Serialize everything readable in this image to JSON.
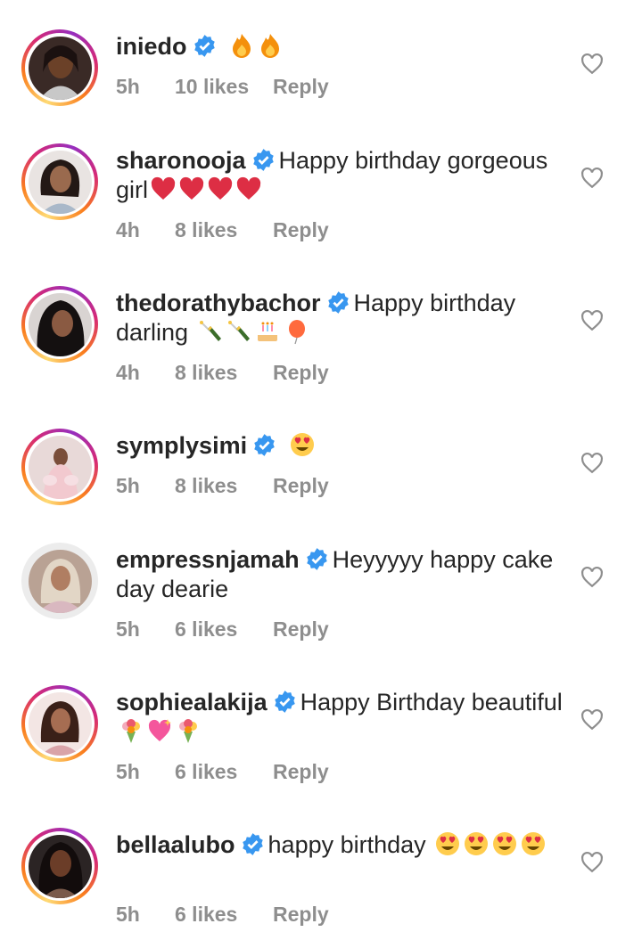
{
  "comments": [
    {
      "username": "iniedo",
      "text": "",
      "emoji": [
        "fire",
        "fire"
      ],
      "time": "5h",
      "likes": "10 likes",
      "reply": "Reply"
    },
    {
      "username": "sharonooja",
      "text": "Happy birthday gorgeous girl",
      "emoji": [
        "heart",
        "heart",
        "heart",
        "heart"
      ],
      "time": "4h",
      "likes": "8 likes",
      "reply": "Reply"
    },
    {
      "username": "thedorathybachor",
      "text": "Happy birthday darling",
      "emoji": [
        "champagne",
        "champagne",
        "cake",
        "balloon"
      ],
      "time": "4h",
      "likes": "8 likes",
      "reply": "Reply"
    },
    {
      "username": "symplysimi",
      "text": "",
      "emoji": [
        "heart-eyes"
      ],
      "time": "5h",
      "likes": "8 likes",
      "reply": "Reply"
    },
    {
      "username": "empressnjamah",
      "text": "Heyyyyy happy cake day dearie",
      "emoji": [],
      "time": "5h",
      "likes": "6 likes",
      "reply": "Reply"
    },
    {
      "username": "sophiealakija",
      "text": "Happy Birthday beautiful",
      "emoji": [
        "bouquet",
        "sparkling-heart",
        "bouquet"
      ],
      "time": "5h",
      "likes": "6 likes",
      "reply": "Reply"
    },
    {
      "username": "bellaalubo",
      "text": "happy birthday",
      "emoji": [
        "heart-eyes",
        "heart-eyes",
        "heart-eyes",
        "heart-eyes"
      ],
      "time": "5h",
      "likes": "6 likes",
      "reply": "Reply"
    }
  ],
  "colors": {
    "verified": "#3897f0",
    "meta": "#8e8e8e",
    "text": "#262626",
    "heart_outline": "#8e8e8e"
  },
  "icons": {
    "verified": "verified-badge-icon",
    "like": "heart-outline-icon"
  }
}
